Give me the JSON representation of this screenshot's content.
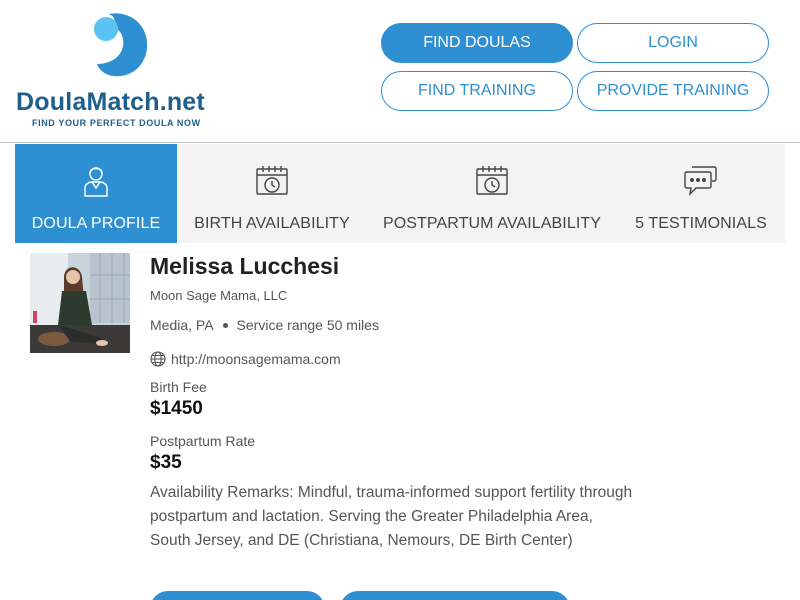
{
  "brand": {
    "name_main": "DoulaMatch",
    "name_suffix": ".net",
    "tagline": "FIND YOUR PERFECT DOULA NOW",
    "logo_colors": {
      "dark": "#2f8fd3",
      "light": "#5bc3f3"
    }
  },
  "nav": {
    "find_doulas": "FIND DOULAS",
    "login": "LOGIN",
    "find_training": "FIND TRAINING",
    "provide_training": "PROVIDE TRAINING"
  },
  "tabs": [
    {
      "label": "DOULA PROFILE",
      "icon": "person-icon",
      "active": true
    },
    {
      "label": "BIRTH AVAILABILITY",
      "icon": "calendar-clock-icon",
      "active": false
    },
    {
      "label": "POSTPARTUM AVAILABILITY",
      "icon": "calendar-clock-icon",
      "active": false
    },
    {
      "label": "5 TESTIMONIALS",
      "icon": "chat-bubbles-icon",
      "active": false
    }
  ],
  "profile": {
    "name": "Melissa Lucchesi",
    "business": "Moon Sage Mama, LLC",
    "location": "Media, PA",
    "service_range": "Service range 50 miles",
    "website": "http://moonsagemama.com",
    "birth_fee_label": "Birth Fee",
    "birth_fee": "$1450",
    "postpartum_rate_label": "Postpartum Rate",
    "postpartum_rate": "$35",
    "remarks": "Availability Remarks: Mindful, trauma-informed support fertility through postpartum and lactation. Serving the Greater Philadelphia Area, South Jersey, and DE (Christiana, Nemours, DE Birth Center)"
  },
  "colors": {
    "accent": "#2f8fd3",
    "brand_text": "#1e5f8c",
    "tab_bg": "#f3f3f3"
  }
}
